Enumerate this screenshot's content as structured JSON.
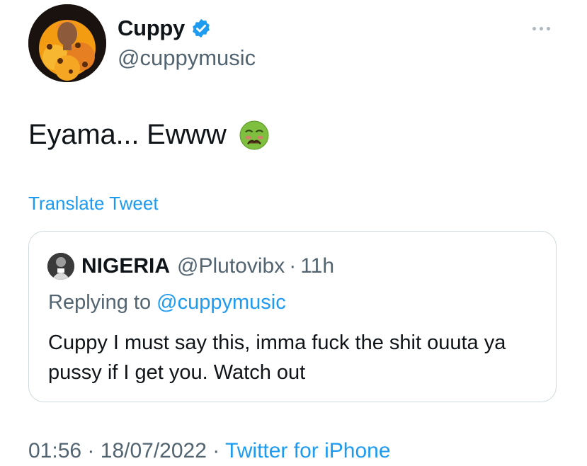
{
  "author": {
    "display_name": "Cuppy",
    "handle": "@cuppymusic",
    "verified_icon": "verified-badge-icon",
    "avatar": "profile-photo"
  },
  "tweet": {
    "text": "Eyama... Ewww",
    "emoji": "nauseated-face-emoji",
    "translate_label": "Translate Tweet"
  },
  "quoted_tweet": {
    "display_name": "NIGERIA",
    "handle": "@Plutovibx",
    "separator": "·",
    "time_ago": "11h",
    "replying_prefix": "Replying to",
    "replying_to": "@cuppymusic",
    "body": "Cuppy I must say this, imma fuck the shit ouuta ya pussy if I get you. Watch out"
  },
  "footer": {
    "time": "01:56",
    "separator": "·",
    "date": "18/07/2022",
    "source": "Twitter for iPhone"
  },
  "colors": {
    "link": "#1d9bf0",
    "muted": "#536471",
    "border": "#cfd9de"
  }
}
